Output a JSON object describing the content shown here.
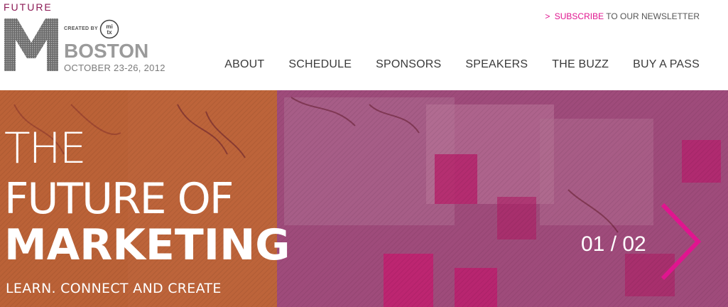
{
  "logo": {
    "future_text": "FUTURE",
    "m_letter": "M",
    "created_by": "CREATED BY",
    "partner_logo_text": "mitx",
    "city": "BOSTON",
    "dates": "OCTOBER 23-26, 2012"
  },
  "newsletter": {
    "arrow": ">",
    "subscribe_label": "SUBSCRIBE",
    "suffix": "TO OUR NEWSLETTER"
  },
  "nav": {
    "items": [
      {
        "label": "ABOUT"
      },
      {
        "label": "SCHEDULE"
      },
      {
        "label": "SPONSORS"
      },
      {
        "label": "SPEAKERS"
      },
      {
        "label": "THE BUZZ"
      },
      {
        "label": "BUY A PASS"
      }
    ]
  },
  "hero": {
    "line1": "THE",
    "line2": "FUTURE OF",
    "line3": "MARKETING",
    "tagline": "LEARN. CONNECT AND CREATE",
    "slide_counter": "01 / 02",
    "next_icon": "chevron-right-icon"
  },
  "colors": {
    "accent": "#e0158f",
    "brand_dark": "#8c1a55",
    "nav_text": "#3a3a3a",
    "hero_text": "#ffffff"
  }
}
